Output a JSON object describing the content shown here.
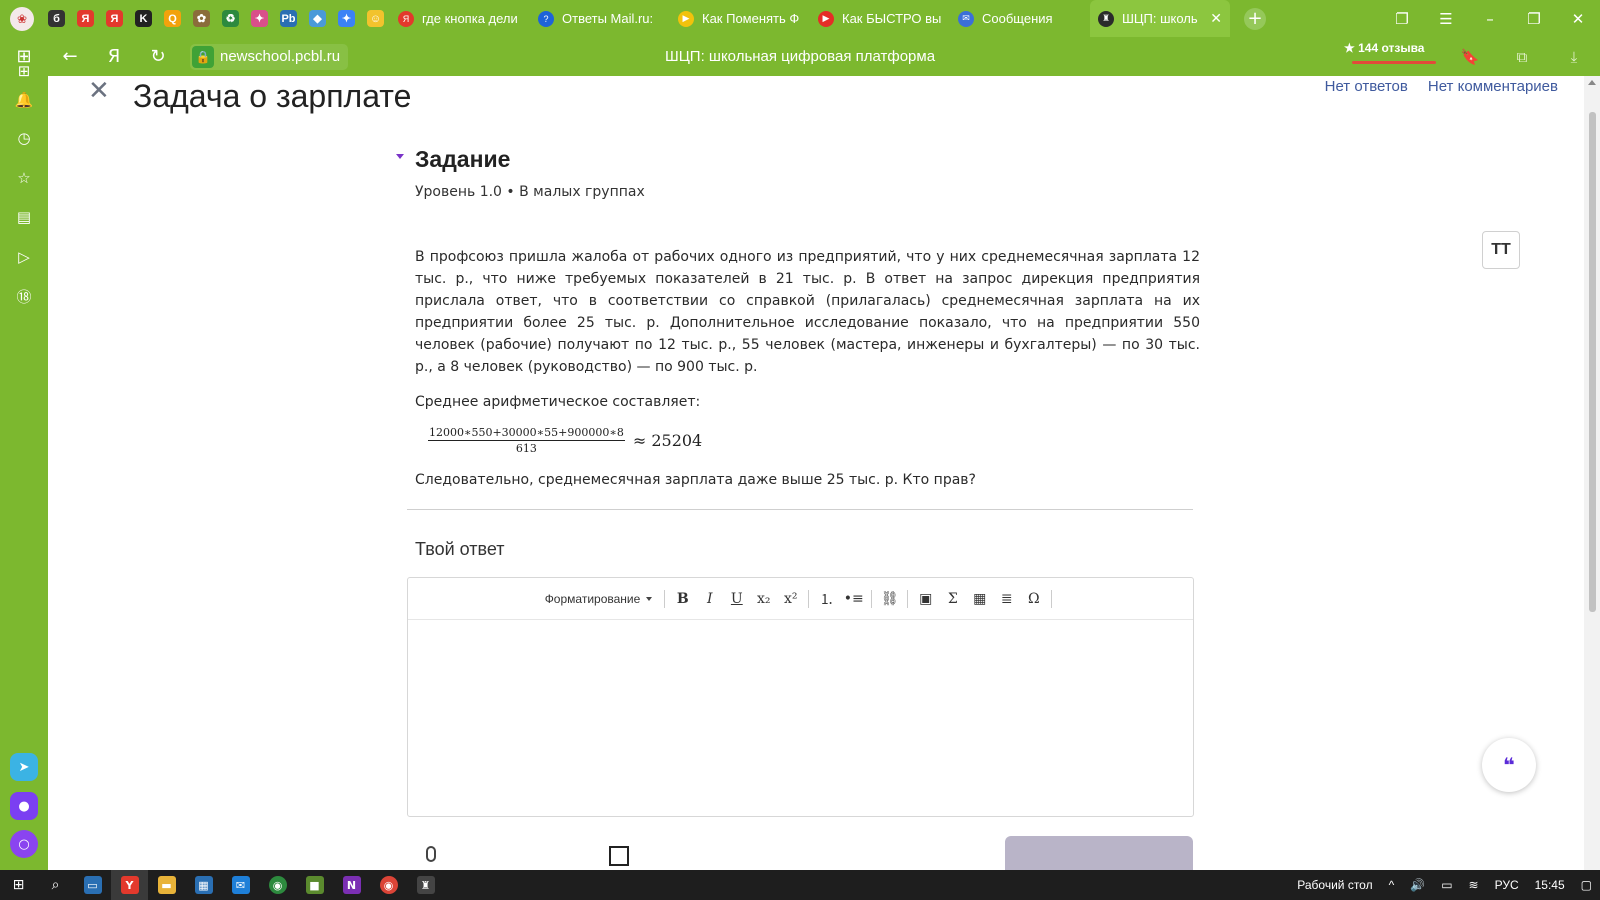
{
  "browser": {
    "pinned_tabs": [
      {
        "icon": "b-icon",
        "letter": "б",
        "color": "#333333"
      },
      {
        "icon": "yandex-icon",
        "letter": "Я",
        "color": "#e3392c"
      },
      {
        "icon": "yandex-icon",
        "letter": "Я",
        "color": "#e3392c"
      },
      {
        "icon": "k-icon",
        "letter": "K",
        "color": "#222222"
      },
      {
        "icon": "search-q-icon",
        "letter": "Q",
        "color": "#f2a20c"
      },
      {
        "icon": "game-icon",
        "letter": "✿",
        "color": "#8a6d3b"
      },
      {
        "icon": "recycle-icon",
        "letter": "♻",
        "color": "#2d8a3e"
      },
      {
        "icon": "pinwheel-icon",
        "letter": "✦",
        "color": "#d94f8a"
      },
      {
        "icon": "pb-icon",
        "letter": "Pb",
        "color": "#2a6fb3"
      },
      {
        "icon": "apps-icon",
        "letter": "◆",
        "color": "#4a9ad9"
      },
      {
        "icon": "star-icon",
        "letter": "✦",
        "color": "#3b82f6"
      },
      {
        "icon": "emoji-icon",
        "letter": "☺",
        "color": "#f2c32d"
      }
    ],
    "tabs": [
      {
        "label": "где кнопка дели",
        "icon": "yandex-icon",
        "color": "#e3392c",
        "letter": "Я"
      },
      {
        "label": "Ответы Mail.ru: ",
        "icon": "question-icon",
        "color": "#1e63d8",
        "letter": "?"
      },
      {
        "label": "Как Поменять Ф",
        "icon": "play-icon",
        "color": "#f2c20c",
        "letter": "▶"
      },
      {
        "label": "Как БЫСТРО вы",
        "icon": "youtube-icon",
        "color": "#e52d27",
        "letter": "▶"
      },
      {
        "label": "Сообщения",
        "icon": "message-icon",
        "color": "#3b6fd8",
        "letter": "✉"
      },
      {
        "label": "ШЦП: школь",
        "icon": "graduation-icon",
        "color": "#2b2b2b",
        "letter": "♜",
        "active": true
      }
    ],
    "address": "newschool.pcbl.ru",
    "page_title": "ШЦП: школьная цифровая платформа",
    "reviews": "★ 144 отзыва"
  },
  "page": {
    "task_title": "Задача о зарплате",
    "links": {
      "answers": "Нет ответов",
      "comments": "Нет комментариев"
    },
    "section_title": "Задание",
    "section_meta": "Уровень 1.0 • В малых группах",
    "task_text": "В профсоюз пришла жалоба от рабочих одного из предприятий, что у них среднемесячная зарплата 12 тыс. р., что ниже требуемых показателей в 21 тыс. р. В ответ на запрос дирекция предприятия прислала ответ, что в соответствии со справкой (прилагалась) среднемесячная зарплата на их предприятии более 25 тыс. р. Дополнительное исследование показало, что на предприятии 550 человек (рабочие) получают по 12 тыс. р., 55 человек (мастера, инженеры и бухгалтеры) — по 30 тыс. р., а 8 человек (руководство) — по 900 тыс. р.",
    "mean_label": "Среднее арифметическое составляет:",
    "formula": {
      "numerator": "12000∗550+30000∗55+900000∗8",
      "denominator": "613",
      "result": "≈ 25204"
    },
    "conclusion": "Следовательно, среднемесячная зарплата даже выше 25 тыс. р. Кто прав?",
    "answer_title": "Твой ответ",
    "editor": {
      "format_label": "Форматирование",
      "buttons": [
        "B",
        "I",
        "U",
        "x₂",
        "x²",
        "⒈",
        "•≡",
        "⛓",
        "▣",
        "Σ",
        "▦",
        "≣",
        "Ω"
      ]
    },
    "text_size_button": "TT"
  },
  "taskbar": {
    "desktop_label": "Рабочий стол",
    "language": "РУС",
    "time": "15:45"
  }
}
